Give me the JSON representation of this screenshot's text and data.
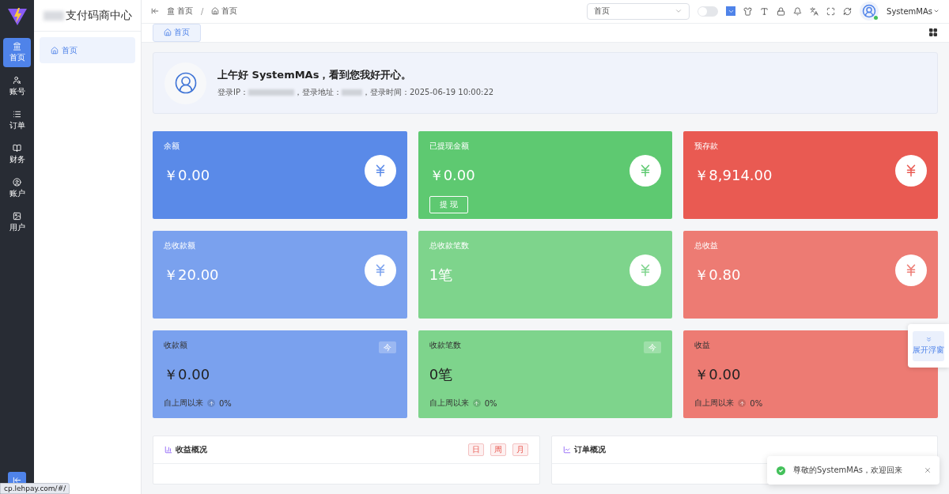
{
  "brand": {
    "title": "支付码商中心"
  },
  "rail": [
    {
      "label": "首页",
      "selected": true
    },
    {
      "label": "账号",
      "selected": false
    },
    {
      "label": "订单",
      "selected": false
    },
    {
      "label": "财务",
      "selected": false
    },
    {
      "label": "账户",
      "selected": false
    },
    {
      "label": "用户",
      "selected": false
    }
  ],
  "submenu": [
    {
      "label": "首页",
      "selected": true
    }
  ],
  "breadcrumb": [
    "首页",
    "首页"
  ],
  "breadcrumb_separator": "/",
  "header": {
    "search_value": "首页",
    "dark_mode": false,
    "user": "SystemMAs"
  },
  "tabs": [
    {
      "label": "首页",
      "selected": true
    }
  ],
  "welcome": {
    "greeting": "上午好 SystemMAs，看到您我好开心。",
    "ip_label": "登录IP：",
    "addr_label": "，登录地址：",
    "time_label": "，登录时间：",
    "time": "2025-06-19 10:00:22"
  },
  "cards": [
    {
      "kind": "icon",
      "title": "余额",
      "value": "￥0.00",
      "color": "#5a8ae8"
    },
    {
      "kind": "icon",
      "title": "已提现金额",
      "value": "￥0.00",
      "color": "#5ec971",
      "button": "提 现"
    },
    {
      "kind": "icon",
      "title": "预存款",
      "value": "￥8,914.00",
      "color": "#e95a52"
    },
    {
      "kind": "icon",
      "title": "总收款额",
      "value": "￥20.00",
      "color": "#7aa1ee"
    },
    {
      "kind": "icon",
      "title": "总收款笔数",
      "value": "1笔",
      "color": "#7ed48c"
    },
    {
      "kind": "icon",
      "title": "总收益",
      "value": "￥0.80",
      "color": "#ed7b73"
    },
    {
      "kind": "trend",
      "title": "收款额",
      "value": "￥0.00",
      "color": "#7aa1ee",
      "badge": "今",
      "footer": "自上周以来",
      "change": "0%"
    },
    {
      "kind": "trend",
      "title": "收款笔数",
      "value": "0笔",
      "color": "#7ed48c",
      "badge": "今",
      "footer": "自上周以来",
      "change": "0%"
    },
    {
      "kind": "trend",
      "title": "收益",
      "value": "￥0.00",
      "color": "#ed7b73",
      "footer": "自上周以来",
      "change": "0%"
    }
  ],
  "panels": [
    {
      "title": "收益概况",
      "periods": [
        "日",
        "周",
        "月"
      ]
    },
    {
      "title": "订单概况"
    }
  ],
  "float_panel": {
    "label": "展开浮窗"
  },
  "toast": {
    "message": "尊敬的SystemMAs，欢迎回来"
  },
  "status_url": "cp.lehpay.com/#/"
}
